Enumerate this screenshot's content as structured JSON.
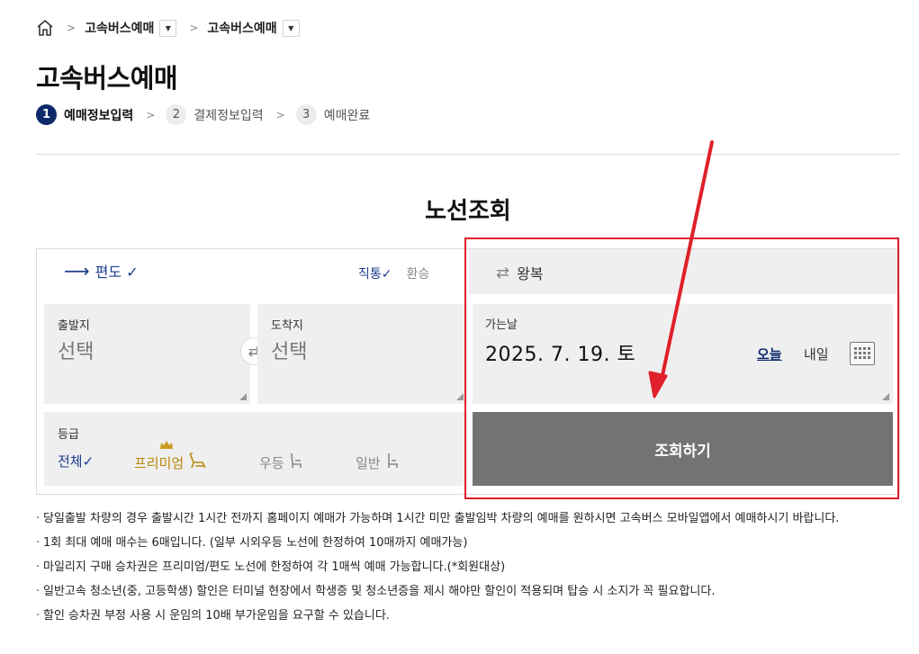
{
  "breadcrumb": {
    "items": [
      {
        "label": "고속버스예매"
      },
      {
        "label": "고속버스예매"
      }
    ]
  },
  "page": {
    "title": "고속버스예매"
  },
  "steps": [
    {
      "num": "1",
      "label": "예매정보입력",
      "active": true
    },
    {
      "num": "2",
      "label": "결제정보입력",
      "active": false
    },
    {
      "num": "3",
      "label": "예매완료",
      "active": false
    }
  ],
  "section": {
    "title": "노선조회"
  },
  "trip": {
    "oneway_label": "편도 ✓",
    "roundtrip_label": "왕복",
    "direct_label": "직통✓",
    "transfer_label": "환승"
  },
  "departure": {
    "label": "출발지",
    "value": "선택"
  },
  "arrival": {
    "label": "도착지",
    "value": "선택"
  },
  "date": {
    "label": "가는날",
    "value": "2025. 7. 19. 토",
    "today": "오늘",
    "tomorrow": "내일"
  },
  "grade": {
    "label": "등급",
    "options": [
      "전체✓",
      "프리미엄",
      "우등",
      "일반"
    ]
  },
  "search_button": "조회하기",
  "notices": [
    "당일출발 차량의 경우 출발시간 1시간 전까지 홈페이지 예매가 가능하며 1시간 미만 출발임박 차량의 예매를 원하시면 고속버스 모바일앱에서 예매하시기 바랍니다.",
    "1회 최대 예매 매수는 6매입니다. (일부 시외우등 노선에 한정하여 10매까지 예매가능)",
    "마일리지 구매 승차권은 프리미엄/편도 노선에 한정하여 각 1매씩 예매 가능합니다.(*회원대상)",
    "일반고속 청소년(중, 고등학생) 할인은 터미널 현장에서 학생증 및 청소년증을 제시 해야만 할인이 적용되며 탑승 시 소지가 꼭 필요합니다.",
    "할인 승차권 부정 사용 시 운임의 10배 부가운임을 요구할 수 있습니다."
  ],
  "colors": {
    "accent": "#0d2a6b",
    "link": "#1a3b8f",
    "premium": "#b8860b",
    "button": "#737373",
    "highlight": "#e0202a"
  }
}
